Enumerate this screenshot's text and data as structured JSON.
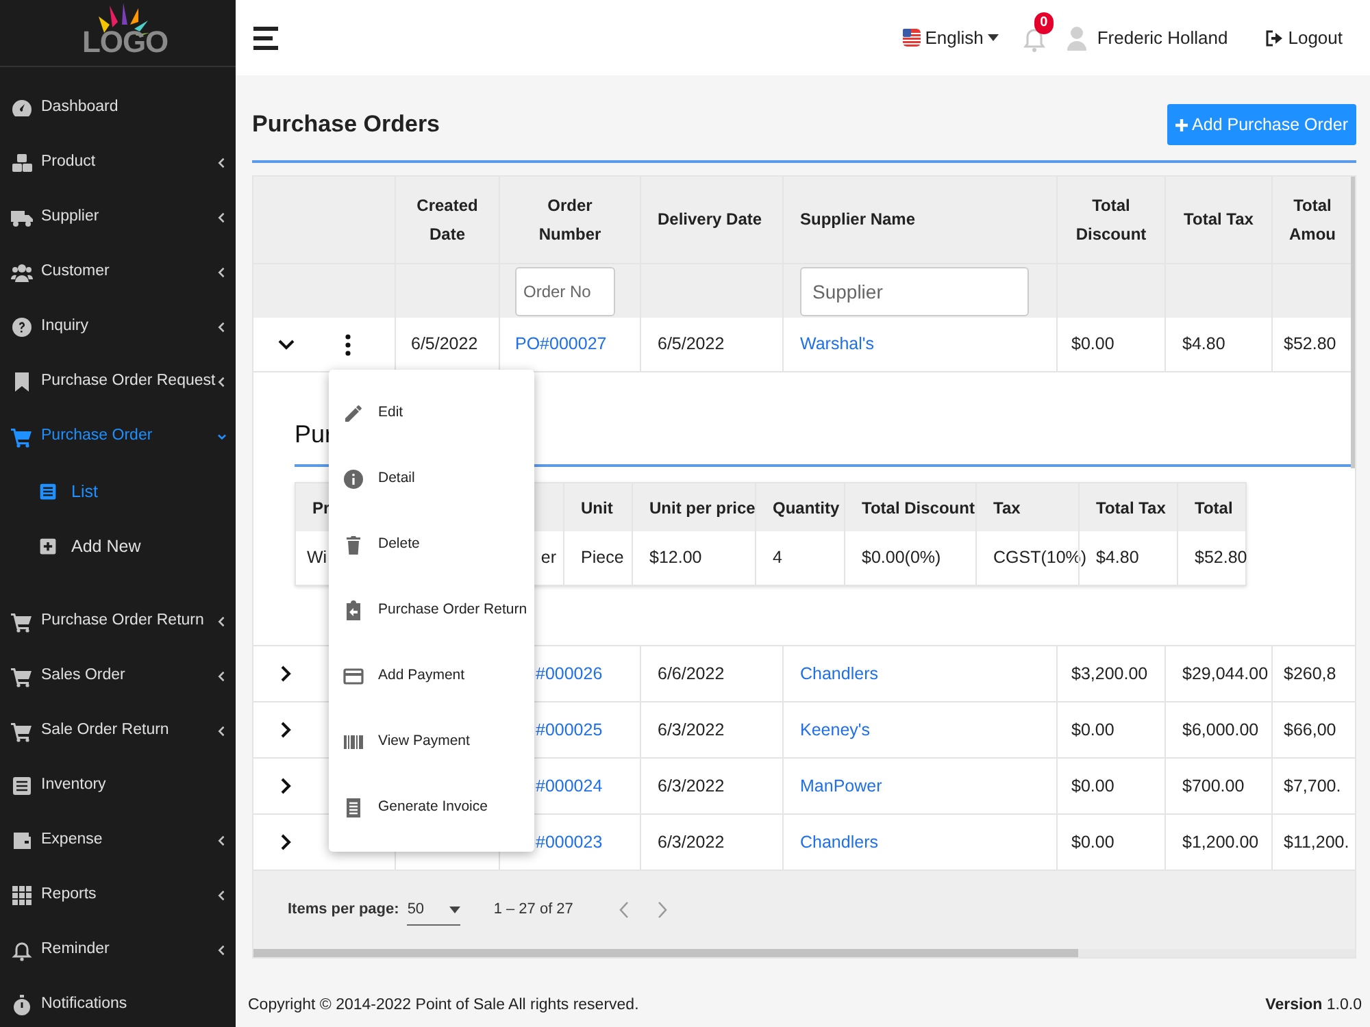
{
  "logo": {
    "text": "LOGO"
  },
  "sidebar": {
    "items": [
      {
        "label": "Dashboard",
        "selected": false
      },
      {
        "label": "Product",
        "selected": false,
        "expanded": false
      },
      {
        "label": "Supplier",
        "selected": false,
        "expanded": false
      },
      {
        "label": "Customer",
        "selected": false,
        "expanded": false
      },
      {
        "label": "Inquiry",
        "selected": false,
        "expanded": false
      },
      {
        "label": "Purchase Order Request",
        "selected": false,
        "expanded": false
      },
      {
        "label": "Purchase Order",
        "selected": true,
        "expanded": true,
        "children": [
          {
            "label": "List",
            "selected": true
          },
          {
            "label": "Add New",
            "selected": false
          }
        ]
      },
      {
        "label": "Purchase Order Return",
        "selected": false,
        "expanded": false
      },
      {
        "label": "Sales Order",
        "selected": false,
        "expanded": false
      },
      {
        "label": "Sale Order Return",
        "selected": false,
        "expanded": false
      },
      {
        "label": "Inventory",
        "selected": false
      },
      {
        "label": "Expense",
        "selected": false,
        "expanded": false
      },
      {
        "label": "Reports",
        "selected": false,
        "expanded": false
      },
      {
        "label": "Reminder",
        "selected": false,
        "expanded": false
      },
      {
        "label": "Notifications",
        "selected": false
      }
    ]
  },
  "header": {
    "language": "English",
    "notification_count": "0",
    "user": "Frederic Holland",
    "logout": "Logout"
  },
  "page": {
    "title": "Purchase Orders",
    "add_button": "Add Purchase Order"
  },
  "table": {
    "columns": [
      "Created Date",
      "Order Number",
      "Delivery Date",
      "Supplier Name",
      "Total Discount",
      "Total Tax",
      "Total Amou"
    ],
    "filters": {
      "order_number": {
        "placeholder": "Order No"
      },
      "supplier": {
        "placeholder": "Supplier"
      }
    },
    "rows": [
      {
        "expanded": true,
        "created": "6/5/2022",
        "order": "PO#000027",
        "delivery": "6/5/2022",
        "supplier": "Warshal's",
        "discount": "$0.00",
        "tax": "$4.80",
        "amount": "$52.80"
      },
      {
        "expanded": false,
        "order": "#000026",
        "delivery": "6/6/2022",
        "supplier": "Chandlers",
        "discount": "$3,200.00",
        "tax": "$29,044.00",
        "amount": "$260,8"
      },
      {
        "expanded": false,
        "order": "#000025",
        "delivery": "6/3/2022",
        "supplier": "Keeney's",
        "discount": "$0.00",
        "tax": "$6,000.00",
        "amount": "$66,00"
      },
      {
        "expanded": false,
        "order": "#000024",
        "delivery": "6/3/2022",
        "supplier": "ManPower",
        "discount": "$0.00",
        "tax": "$700.00",
        "amount": "$7,700."
      },
      {
        "expanded": false,
        "order": "#000023",
        "delivery": "6/3/2022",
        "supplier": "Chandlers",
        "discount": "$0.00",
        "tax": "$1,200.00",
        "amount": "$11,200."
      }
    ],
    "detail": {
      "title": "Pur",
      "columns": [
        "Pr",
        "",
        "Unit",
        "Unit per price",
        "Quantity",
        "Total Discount",
        "Tax",
        "Total Tax",
        "Total"
      ],
      "rows": [
        [
          "Wi",
          "er",
          "Piece",
          "$12.00",
          "4",
          "$0.00(0%)",
          "CGST(10%)",
          "$4.80",
          "$52.80"
        ]
      ]
    },
    "paginator": {
      "label": "Items per page:",
      "page_size": "50",
      "range": "1 – 27 of 27"
    }
  },
  "row_menu": {
    "items": [
      {
        "label": "Edit"
      },
      {
        "label": "Detail"
      },
      {
        "label": "Delete"
      },
      {
        "label": "Purchase Order Return"
      },
      {
        "label": "Add Payment"
      },
      {
        "label": "View Payment"
      },
      {
        "label": "Generate Invoice"
      }
    ]
  },
  "footer": {
    "copyright": "Copyright © 2014-2022 Point of Sale All rights reserved.",
    "version": "**Version** 1.0.0"
  }
}
